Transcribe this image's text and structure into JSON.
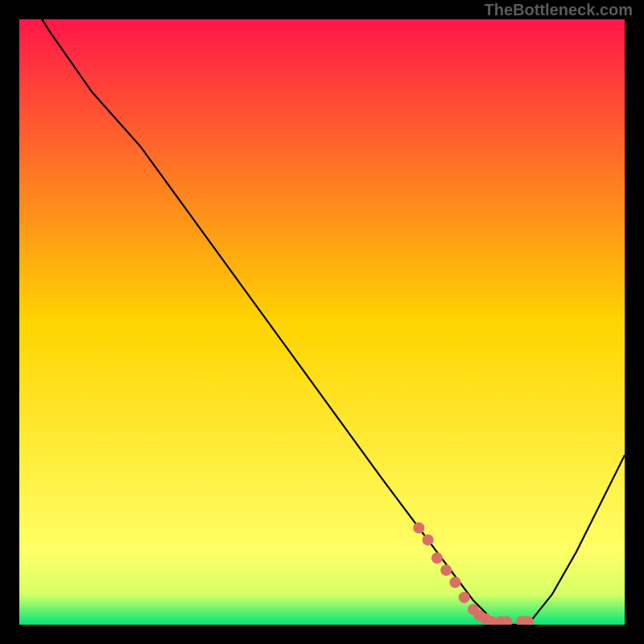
{
  "watermark": "TheBottleneck.com",
  "chart_data": {
    "type": "line",
    "title": "",
    "xlabel": "",
    "ylabel": "",
    "xlim": [
      0,
      100
    ],
    "ylim": [
      0,
      100
    ],
    "grid": false,
    "legend": false,
    "background": {
      "type": "vertical-gradient",
      "stops": [
        {
          "offset": 0,
          "color": "#ff1749"
        },
        {
          "offset": 50,
          "color": "#ffd400"
        },
        {
          "offset": 88,
          "color": "#ffff66"
        },
        {
          "offset": 95,
          "color": "#d6ff66"
        },
        {
          "offset": 100,
          "color": "#00e676"
        }
      ]
    },
    "series": [
      {
        "name": "curve",
        "color": "#000000",
        "x": [
          0,
          5,
          12,
          20,
          28,
          36,
          44,
          52,
          60,
          66,
          72,
          75,
          78,
          80,
          82,
          84,
          88,
          92,
          96,
          100
        ],
        "y": [
          106,
          98,
          88,
          79,
          68,
          57,
          46,
          35,
          24,
          16,
          8,
          4,
          1,
          0,
          0,
          0,
          5,
          12,
          20,
          28
        ]
      }
    ],
    "markers": {
      "name": "highlight-dots",
      "color": "#d97066",
      "points": [
        {
          "x": 66,
          "y": 16
        },
        {
          "x": 67.5,
          "y": 14
        },
        {
          "x": 69,
          "y": 11
        },
        {
          "x": 70.5,
          "y": 9
        },
        {
          "x": 72,
          "y": 7
        },
        {
          "x": 73.5,
          "y": 4.5
        },
        {
          "x": 75,
          "y": 2.5
        },
        {
          "x": 76,
          "y": 1.5
        },
        {
          "x": 77,
          "y": 1
        },
        {
          "x": 78,
          "y": 0.5
        },
        {
          "x": 79.5,
          "y": 0.5
        },
        {
          "x": 80.5,
          "y": 0.5
        },
        {
          "x": 83,
          "y": 0.5
        },
        {
          "x": 84,
          "y": 0.5
        }
      ]
    }
  }
}
